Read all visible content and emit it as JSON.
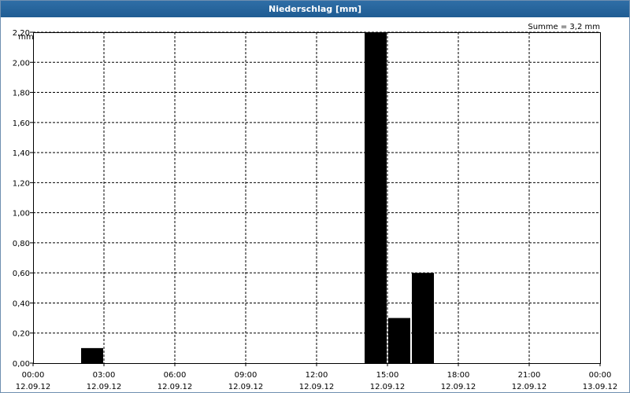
{
  "window": {
    "title": "Niederschlag [mm]"
  },
  "summary": "Summe = 3,2 mm",
  "chart_data": {
    "type": "bar",
    "title": "Niederschlag [mm]",
    "ylabel": "mm",
    "xlabel": "",
    "ylim": [
      0,
      2.2
    ],
    "y_ticks": [
      "0,00",
      "0,20",
      "0,40",
      "0,60",
      "0,80",
      "1,00",
      "1,20",
      "1,40",
      "1,60",
      "1,80",
      "2,00",
      "2,20"
    ],
    "x_ticks": [
      {
        "time": "00:00",
        "date": "12.09.12"
      },
      {
        "time": "03:00",
        "date": "12.09.12"
      },
      {
        "time": "06:00",
        "date": "12.09.12"
      },
      {
        "time": "09:00",
        "date": "12.09.12"
      },
      {
        "time": "12:00",
        "date": "12.09.12"
      },
      {
        "time": "15:00",
        "date": "12.09.12"
      },
      {
        "time": "18:00",
        "date": "12.09.12"
      },
      {
        "time": "21:00",
        "date": "12.09.12"
      },
      {
        "time": "00:00",
        "date": "13.09.12"
      }
    ],
    "grid": true,
    "bar_color": "#000000",
    "bars": [
      {
        "start": "12.09.12 02:00",
        "end": "12.09.12 03:00",
        "value": 0.1
      },
      {
        "start": "12.09.12 14:00",
        "end": "12.09.12 15:00",
        "value": 2.2
      },
      {
        "start": "12.09.12 15:00",
        "end": "12.09.12 16:00",
        "value": 0.3
      },
      {
        "start": "12.09.12 16:00",
        "end": "12.09.12 17:00",
        "value": 0.6
      }
    ]
  }
}
